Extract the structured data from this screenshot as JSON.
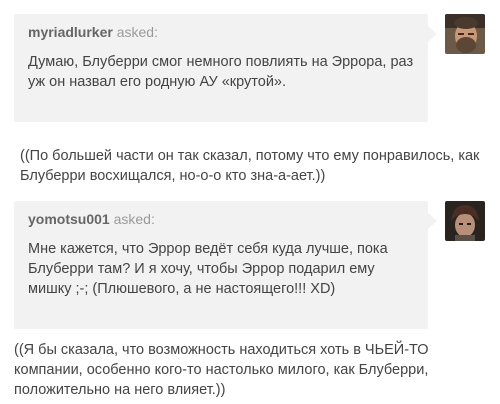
{
  "posts": [
    {
      "asker": "myriadlurker",
      "asked_label": "asked:",
      "question": "Думаю, Блуберри смог немного повлиять на Эррора, раз уж он назвал его родную АУ «крутой».",
      "answer": "((По большей части он так сказал, потому что ему понравилось, как Блуберри восхищался, но-о-о кто зна-а-ает.))",
      "avatar_icon": "bearded-man-avatar"
    },
    {
      "asker": "yomotsu001",
      "asked_label": "asked:",
      "question": "Мне кажется, что Эррор ведёт себя куда лучше, пока Блуберри там? И я хочу, чтобы Эррор подарил ему мишку ;-; (Плюшевого, а не настоящего!!! XD)",
      "answer": "((Я бы сказала, что возможность находиться хоть в ЧЬЕЙ-ТО компании, особенно кого-то настолько милого, как Блуберри, положительно на него влияет.))",
      "avatar_icon": "dark-character-avatar"
    }
  ],
  "colors": {
    "bubble_bg": "#f2f2f2",
    "text": "#444444",
    "asker_name": "#666666",
    "muted": "#9a9a9a"
  }
}
